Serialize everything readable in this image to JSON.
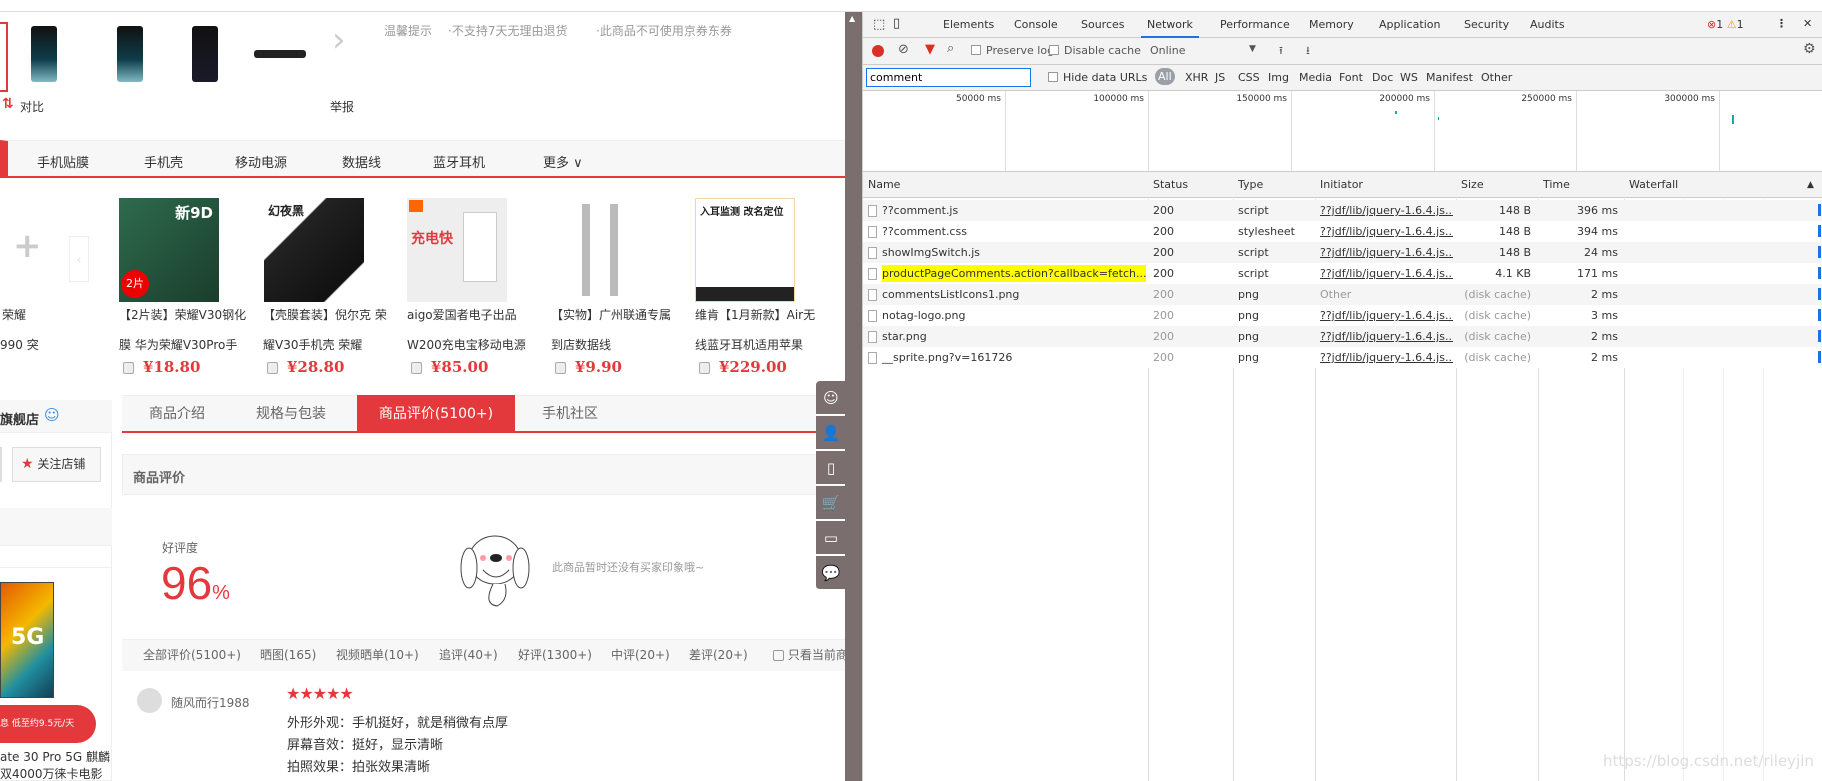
{
  "page": {
    "tips": [
      "温馨提示",
      "·不支持7天无理由退货",
      "·此商品不可使用京券东券"
    ],
    "compare": "对比",
    "report": "举报",
    "categories": [
      "手机贴膜",
      "手机壳",
      "移动电源",
      "数据线",
      "蓝牙耳机",
      "更多"
    ],
    "left_rec": {
      "title_line1": "荣耀",
      "title_line2": "990 突"
    },
    "recommendations": [
      {
        "title": "【2片装】荣耀V30钢化膜 华为荣耀V30Pro手机",
        "price": "¥18.80",
        "badge": "新9D"
      },
      {
        "title": "【壳膜套装】倪尔克 荣耀V30手机壳 荣耀V30Pro",
        "price": "¥28.80",
        "badge": "幻夜黑"
      },
      {
        "title": "aigo爱国者电子出品W200充电宝移动电源便",
        "price": "¥85.00",
        "badge": "充电快"
      },
      {
        "title": "【实物】广州联通专属到店数据线",
        "price": "¥9.90",
        "badge": ""
      },
      {
        "title": "维肯【1月新款】Air无线蓝牙耳机适用苹果",
        "price": "¥229.00",
        "badge": "入耳监测 改名定位"
      }
    ],
    "shop": {
      "name": "旗舰店",
      "follow": "关注店铺"
    },
    "side_product": {
      "line1": "ate 30 Pro 5G 麒麟",
      "line2": "双4000万徕卡电影",
      "banner": "息 低至约9.5元/天",
      "label_5g": "5G"
    },
    "tabs": [
      "商品介绍",
      "规格与包装",
      "商品评价(5100+)",
      "手机社区"
    ],
    "active_tab": 2,
    "review_section": {
      "title": "商品评价",
      "rate_label": "好评度",
      "rate_value": "96",
      "rate_unit": "%",
      "impression_empty": "此商品暂时还没有买家印象哦~"
    },
    "filters": [
      "全部评价(5100+)",
      "晒图(165)",
      "视频晒单(10+)",
      "追评(40+)",
      "好评(1300+)",
      "中评(20+)",
      "差评(20+)",
      "只看当前商"
    ],
    "review": {
      "user": "随风而行1988",
      "stars": 5,
      "lines": [
        "外形外观：手机挺好，就是稍微有点厚",
        "屏幕音效：挺好，显示清晰",
        "拍照效果：拍张效果清晰"
      ]
    }
  },
  "devtools": {
    "tabs": [
      "Elements",
      "Console",
      "Sources",
      "Network",
      "Performance",
      "Memory",
      "Application",
      "Security",
      "Audits"
    ],
    "active_tab": "Network",
    "errors": "1",
    "warnings": "1",
    "toolbar": {
      "preserve_log": "Preserve log",
      "disable_cache": "Disable cache",
      "throttle": "Online"
    },
    "filter": {
      "value": "comment",
      "hide_data_urls": "Hide data URLs",
      "types": [
        "All",
        "XHR",
        "JS",
        "CSS",
        "Img",
        "Media",
        "Font",
        "Doc",
        "WS",
        "Manifest",
        "Other"
      ],
      "active_type": "All"
    },
    "timeline_ticks": [
      "50000 ms",
      "100000 ms",
      "150000 ms",
      "200000 ms",
      "250000 ms",
      "300000 ms"
    ],
    "columns": [
      "Name",
      "Status",
      "Type",
      "Initiator",
      "Size",
      "Time",
      "Waterfall"
    ],
    "rows": [
      {
        "name": "??comment.js",
        "status": "200",
        "type": "script",
        "initiator": "??jdf/lib/jquery-1.6.4.js...",
        "size": "148 B",
        "time": "396 ms"
      },
      {
        "name": "??comment.css",
        "status": "200",
        "type": "stylesheet",
        "initiator": "??jdf/lib/jquery-1.6.4.js...",
        "size": "148 B",
        "time": "394 ms"
      },
      {
        "name": "showImgSwitch.js",
        "status": "200",
        "type": "script",
        "initiator": "??jdf/lib/jquery-1.6.4.js...",
        "size": "148 B",
        "time": "24 ms"
      },
      {
        "name": "productPageComments.action?callback=fetch...",
        "status": "200",
        "type": "script",
        "initiator": "??jdf/lib/jquery-1.6.4.js...",
        "size": "4.1 KB",
        "time": "171 ms",
        "highlighted": true
      },
      {
        "name": "commentsListIcons1.png",
        "status": "200",
        "type": "png",
        "initiator": "Other",
        "size": "(disk cache)",
        "time": "2 ms"
      },
      {
        "name": "notag-logo.png",
        "status": "200",
        "type": "png",
        "initiator": "??jdf/lib/jquery-1.6.4.js...",
        "size": "(disk cache)",
        "time": "3 ms"
      },
      {
        "name": "star.png",
        "status": "200",
        "type": "png",
        "initiator": "??jdf/lib/jquery-1.6.4.js...",
        "size": "(disk cache)",
        "time": "2 ms"
      },
      {
        "name": "__sprite.png?v=161726",
        "status": "200",
        "type": "png",
        "initiator": "??jdf/lib/jquery-1.6.4.js...",
        "size": "(disk cache)",
        "time": "2 ms"
      }
    ]
  },
  "watermark": "https://blog.csdn.net/rileyjin",
  "colors": {
    "jd_red": "#e4393c",
    "devtools_blue": "#1a73e8",
    "highlight": "#ffff00",
    "side_toolbar": "#7a6e6e"
  }
}
